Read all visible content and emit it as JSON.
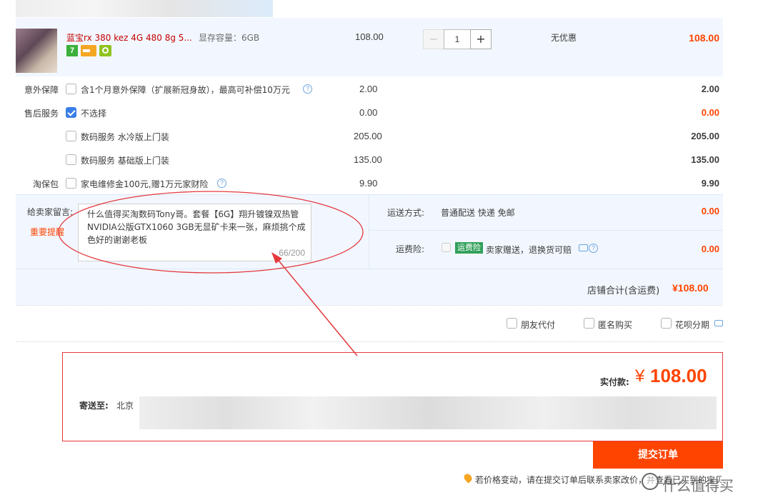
{
  "product": {
    "title": "蓝宝rx 380 kez 4G 480 8g 5...",
    "spec": "显存容量：6GB",
    "unit_price": "108.00",
    "quantity": "1",
    "discount": "无优惠",
    "subtotal": "108.00"
  },
  "services": [
    {
      "section": "意外保障",
      "label": "含1个月意外保障（扩展新冠身故），最高可补偿10万元",
      "price": "2.00",
      "total": "2.00",
      "checked": false,
      "help": true
    },
    {
      "section": "售后服务",
      "label": "不选择",
      "price": "0.00",
      "total": "0.00",
      "checked": true,
      "help": false
    },
    {
      "section": "",
      "label": "数码服务 水冷版上门装",
      "price": "205.00",
      "total": "205.00",
      "checked": false,
      "help": false
    },
    {
      "section": "",
      "label": "数码服务 基础版上门装",
      "price": "135.00",
      "total": "135.00",
      "checked": false,
      "help": false
    },
    {
      "section": "淘保包",
      "label": "家电维修金100元,赠1万元家财险",
      "price": "9.90",
      "total": "9.90",
      "checked": false,
      "help": true
    }
  ],
  "message": {
    "label": "给卖家留言:",
    "reminder": "重要提醒",
    "text": "什么值得买淘数码Tony哥。套餐【6G】翔升镀镍双热管NVIDIA公版GTX1060 3GB无显矿卡来一张，麻烦挑个成色好的谢谢老板",
    "counter": "66/200"
  },
  "shipping": {
    "label": "运送方式:",
    "method": "普通配送 快递 免邮",
    "price": "0.00"
  },
  "insurance": {
    "label": "运费险:",
    "badge": "运费险",
    "text": "卖家赠送，退换货可赔",
    "price": "0.00"
  },
  "store_total": {
    "label": "店铺合计(含运费)",
    "value": "¥108.00"
  },
  "options": {
    "friend_pay": "朋友代付",
    "anonymous": "匿名购买",
    "installment": "花呗分期"
  },
  "summary": {
    "pay_label": "实付款:",
    "currency": "¥",
    "amount": "108.00",
    "address_label": "寄送至:",
    "address_city": "北京"
  },
  "submit_button": "提交订单",
  "footer_note": "若价格变动，请在提交订单后联系卖家改价，并查看已买到的宝贝",
  "watermark": "什么值得买",
  "colors": {
    "accent": "#ff4400",
    "link_red": "#c40000",
    "highlight_bg": "#f2f7ff",
    "annotation": "#e4393c"
  }
}
